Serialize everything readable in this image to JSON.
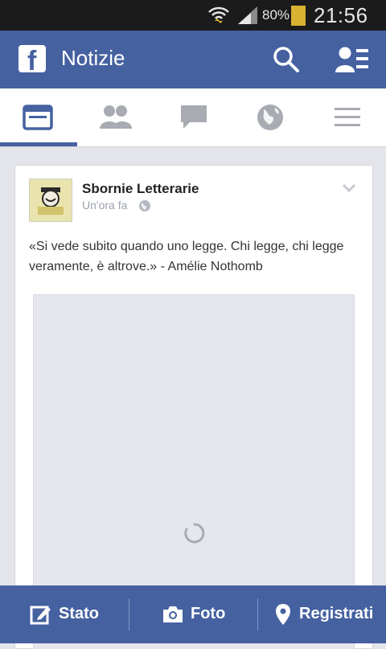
{
  "status_bar": {
    "battery_percent": "80%",
    "time": "21:56"
  },
  "app_bar": {
    "title": "Notizie"
  },
  "tabs": [
    {
      "icon": "news-feed-icon",
      "active": true
    },
    {
      "icon": "friends-icon",
      "active": false
    },
    {
      "icon": "messages-icon",
      "active": false
    },
    {
      "icon": "globe-icon",
      "active": false
    },
    {
      "icon": "menu-icon",
      "active": false
    }
  ],
  "post": {
    "author": "Sbornie Letterarie",
    "time": "Un'ora fa",
    "text": "«Si vede subito quando uno legge. Chi legge, chi legge veramente, è altrove.» - Amélie Nothomb",
    "avatar_caption": "sbornie letterarie"
  },
  "bottom_bar": {
    "status_label": "Stato",
    "photo_label": "Foto",
    "checkin_label": "Registrati"
  },
  "colors": {
    "brand": "#4561a0",
    "statusbar": "#1b1b1b",
    "battery": "#d8b230"
  }
}
